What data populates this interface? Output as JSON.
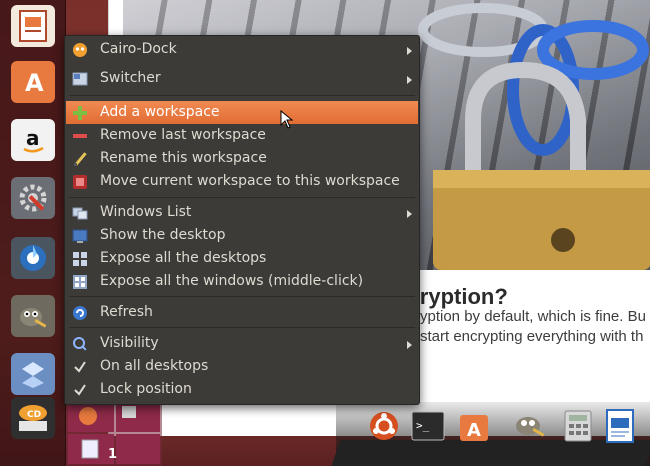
{
  "article": {
    "heading": "ou Use Encryption?",
    "line1": "yption by default, which is fine. Bu",
    "line2": "start encrypting everything with th"
  },
  "launcher": {
    "items": [
      {
        "name": "impress-icon"
      },
      {
        "name": "software-center-icon"
      },
      {
        "name": "amazon-icon"
      },
      {
        "name": "system-settings-icon"
      },
      {
        "name": "shotwell-icon"
      },
      {
        "name": "gimp-icon"
      },
      {
        "name": "dropbox-icon"
      },
      {
        "name": "cairo-dock-icon"
      }
    ]
  },
  "dock": {
    "workspace_number": "1",
    "items": [
      "ubuntu-icon",
      "terminal-icon",
      "software-center-icon",
      "gimp-icon",
      "calculator-icon",
      "writer-icon"
    ]
  },
  "menu": {
    "cairo_dock": "Cairo-Dock",
    "switcher": "Switcher",
    "add_workspace": "Add a workspace",
    "remove_workspace": "Remove last workspace",
    "rename_workspace": "Rename this workspace",
    "move_workspace": "Move current workspace to this workspace",
    "windows_list": "Windows List",
    "show_desktop": "Show the desktop",
    "expose_desktops": "Expose all the desktops",
    "expose_windows": "Expose all the windows (middle-click)",
    "refresh": "Refresh",
    "visibility": "Visibility",
    "on_all_desktops": "On all desktops",
    "lock_position": "Lock position"
  },
  "colors": {
    "menu_bg": "#3c3b37",
    "menu_highlight": "#e8793f",
    "menu_text": "#dfdbd2"
  }
}
